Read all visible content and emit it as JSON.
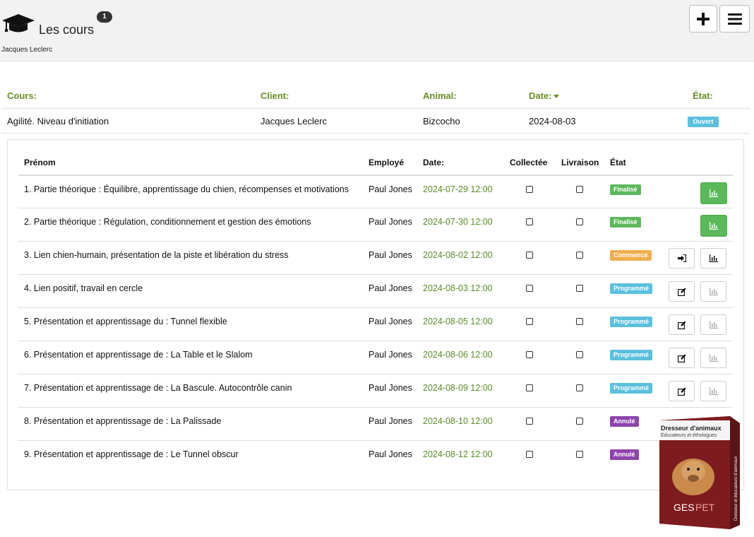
{
  "header": {
    "title": "Les cours",
    "count": "1",
    "subtitle": "Jacques Leclerc"
  },
  "main_table": {
    "headers": {
      "course": "Cours:",
      "client": "Client:",
      "animal": "Animal:",
      "date": "Date:",
      "state": "État:"
    },
    "row": {
      "course": "Agilité. Niveau d'initiation",
      "client": "Jacques Leclerc",
      "animal": "Bizcocho",
      "date": "2024-08-03",
      "state": "Ouvert"
    }
  },
  "sessions": {
    "headers": {
      "name": "Prénom",
      "employee": "Employé",
      "date": "Date:",
      "collected": "Collectée",
      "delivery": "Livraison",
      "state": "État"
    },
    "rows": [
      {
        "name": "1. Partie théorique : Équilibre, apprentissage du chien, récompenses et motivations",
        "employee": "Paul Jones",
        "date": "2024-07-29 12:00",
        "state": "Finalisé"
      },
      {
        "name": "2. Partie théorique : Régulation, conditionnement et gestion des émotions",
        "employee": "Paul Jones",
        "date": "2024-07-30 12:00",
        "state": "Finalisé"
      },
      {
        "name": "3. Lien chien-humain, présentation de la piste et libération du stress",
        "employee": "Paul Jones",
        "date": "2024-08-02 12:00",
        "state": "Commencé"
      },
      {
        "name": "4. Lien positif, travail en cercle",
        "employee": "Paul Jones",
        "date": "2024-08-03 12:00",
        "state": "Programmé"
      },
      {
        "name": "5. Présentation et apprentissage du : Tunnel flexible",
        "employee": "Paul Jones",
        "date": "2024-08-05 12:00",
        "state": "Programmé"
      },
      {
        "name": "6. Présentation et apprentissage de : La Table et le Slalom",
        "employee": "Paul Jones",
        "date": "2024-08-06 12:00",
        "state": "Programmé"
      },
      {
        "name": "7. Présentation et apprentissage de : La Bascule. Autocontrôle canin",
        "employee": "Paul Jones",
        "date": "2024-08-09 12:00",
        "state": "Programmé"
      },
      {
        "name": "8. Présentation et apprentissage de : La Palissade",
        "employee": "Paul Jones",
        "date": "2024-08-10 12:00",
        "state": "Annulé"
      },
      {
        "name": "9. Présentation et apprentissage de : Le Tunnel obscur",
        "employee": "Paul Jones",
        "date": "2024-08-12 12:00",
        "state": "Annulé"
      }
    ]
  },
  "status_colors": {
    "Finalisé": "#5cb85c",
    "Commencé": "#f0ad4e",
    "Programmé": "#5bc0de",
    "Annulé": "#8e44ad",
    "Ouvert": "#5bc0de"
  },
  "product_box": {
    "title": "Dresseur d'animaux",
    "subtitle": "Éducateurs et éthologues",
    "brand_a": "GES",
    "brand_b": "PET",
    "side": "Dresseur et éducateurs d'animaux"
  },
  "icons": [
    "graduation-cap-icon",
    "plus-icon",
    "hamburger-menu-icon",
    "sort-caret-icon",
    "bar-chart-icon",
    "sign-in-icon",
    "edit-icon"
  ]
}
